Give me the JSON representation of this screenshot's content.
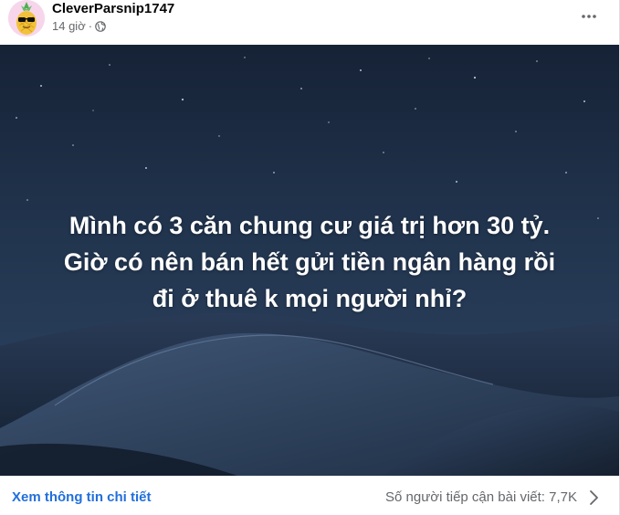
{
  "post": {
    "author": "CleverParsnip1747",
    "time": "14 giờ",
    "separator": "·",
    "audience_icon": "globe-icon",
    "image_text_lines": [
      "Mình có 3 căn chung cư giá trị hơn 30 tỷ.",
      "Giờ có nên bán hết gửi tiền ngân hàng rồi",
      "đi ở thuê k mọi người nhỉ?"
    ]
  },
  "footer": {
    "details_link": "Xem thông tin chi tiết",
    "reach_text": "Số người tiếp cận bài viết: 7,7K"
  },
  "colors": {
    "link": "#216fdb",
    "secondary_text": "#65676b",
    "primary_text": "#050505",
    "avatar_bg": "#f7d6ec"
  }
}
